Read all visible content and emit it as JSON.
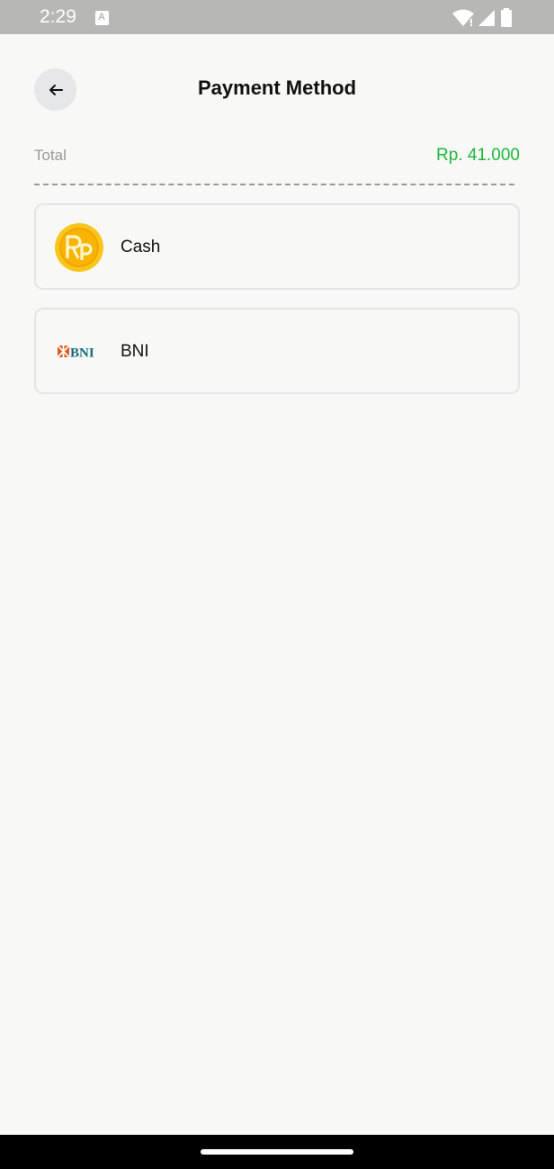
{
  "status_bar": {
    "time": "2:29",
    "icons": [
      "a-notification-icon",
      "wifi-icon",
      "signal-icon",
      "battery-icon"
    ]
  },
  "header": {
    "title": "Payment Method",
    "back_icon": "arrow-left-icon"
  },
  "summary": {
    "total_label": "Total",
    "total_value": "Rp. 41.000"
  },
  "methods": [
    {
      "label": "Cash",
      "icon": "rupiah-coin-icon"
    },
    {
      "label": "BNI",
      "icon": "bni-logo-icon",
      "logo_text": "BNI"
    }
  ],
  "colors": {
    "accent_green": "#1db93a",
    "background": "#f8f8f6",
    "status_bar": "#b7b7b5",
    "coin_gold": "#f5b800",
    "bni_orange": "#e35a1d",
    "bni_teal": "#0d6a7a"
  }
}
